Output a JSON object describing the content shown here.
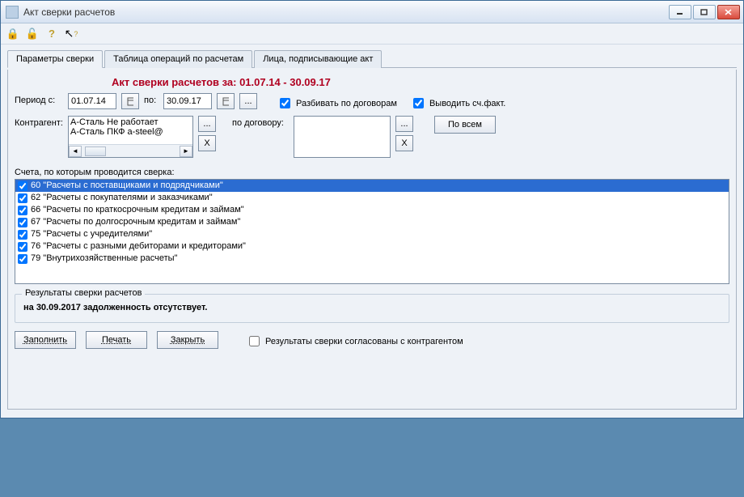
{
  "window": {
    "title": "Акт сверки расчетов"
  },
  "toolbar_icons": {
    "icon1": "lock-icon",
    "icon2": "lock-gear-icon",
    "icon3": "help-icon",
    "icon4": "cursor-help-icon"
  },
  "tabs": [
    {
      "label": "Параметры сверки",
      "active": true
    },
    {
      "label": "Таблица операций по расчетам",
      "active": false
    },
    {
      "label": "Лица, подписывающие акт",
      "active": false
    }
  ],
  "header_title": "Акт сверки расчетов за: 01.07.14 - 30.09.17",
  "period": {
    "label_from": "Период с:",
    "from": "01.07.14",
    "label_to": "по:",
    "to": "30.09.17",
    "ellipsis": "..."
  },
  "checkboxes": {
    "split_contracts": {
      "label": "Разбивать по договорам",
      "checked": true
    },
    "show_invoice": {
      "label": "Выводить сч.факт.",
      "checked": true
    },
    "agreed": {
      "label": "Результаты сверки согласованы с контрагентом",
      "checked": false
    }
  },
  "contragent": {
    "label": "Контрагент:",
    "items": [
      "А-Сталь  Не работает",
      "А-Сталь ПКФ          a-steel@"
    ],
    "clear_btn": "X"
  },
  "contract": {
    "label": "по договору:",
    "clear_btn": "X",
    "all_btn": "По всем"
  },
  "accounts": {
    "legend": "Счета, по которым проводится сверка:",
    "items": [
      {
        "label": "60 \"Расчеты с поставщиками и подрядчиками\"",
        "checked": true,
        "selected": true
      },
      {
        "label": "62 \"Расчеты с покупателями и заказчиками\"",
        "checked": true,
        "selected": false
      },
      {
        "label": "66 \"Расчеты по краткосрочным кредитам и займам\"",
        "checked": true,
        "selected": false
      },
      {
        "label": "67 \"Расчеты по долгосрочным кредитам и займам\"",
        "checked": true,
        "selected": false
      },
      {
        "label": "75 \"Расчеты с учредителями\"",
        "checked": true,
        "selected": false
      },
      {
        "label": "76 \"Расчеты с разными дебиторами и кредиторами\"",
        "checked": true,
        "selected": false
      },
      {
        "label": "79 \"Внутрихозяйственные расчеты\"",
        "checked": true,
        "selected": false
      }
    ]
  },
  "results": {
    "legend": "Результаты сверки расчетов",
    "text": "на 30.09.2017 задолженность отсутствует."
  },
  "buttons": {
    "fill": "Заполнить",
    "print": "Печать",
    "close": "Закрыть"
  }
}
